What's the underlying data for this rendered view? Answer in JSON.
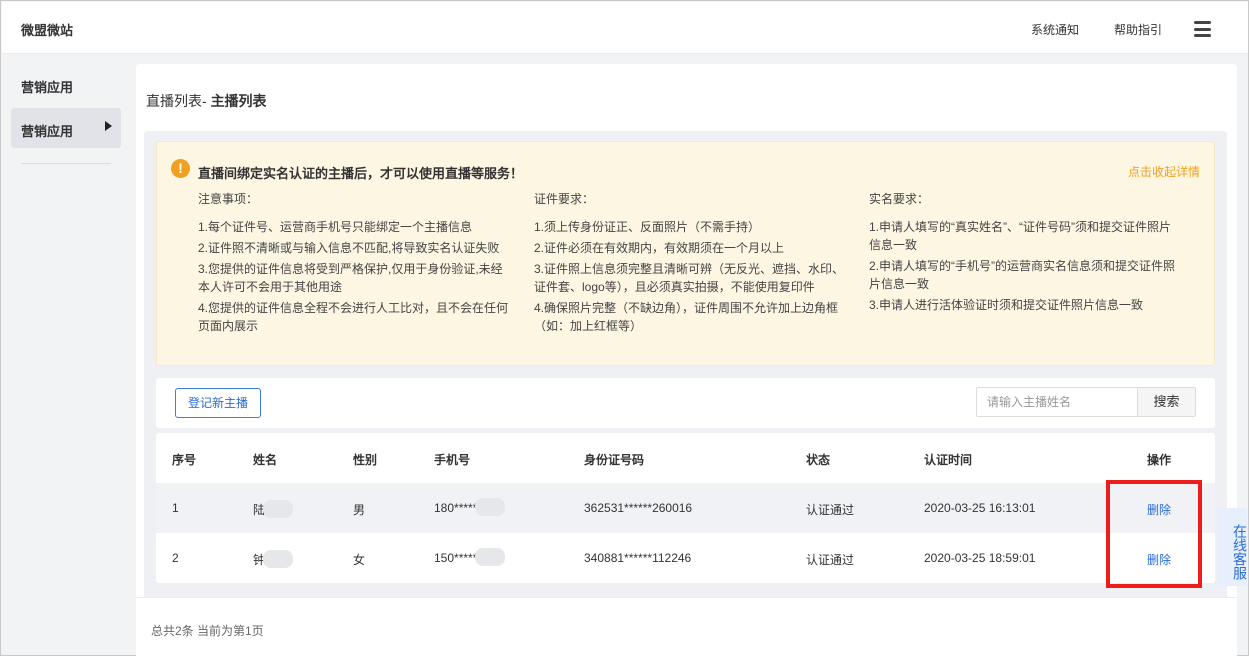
{
  "header": {
    "brand": "微盟微站",
    "nav": [
      "系统通知",
      "帮助指引"
    ],
    "menu_icon": "hamburger-menu-icon"
  },
  "sidebar": {
    "heading": "营销应用",
    "items": [
      {
        "label": "营销应用"
      }
    ]
  },
  "breadcrumb": {
    "parent": "直播列表- ",
    "current": "主播列表"
  },
  "notice": {
    "icon": "exclamation-icon",
    "title": "直播间绑定实名认证的主播后，才可以使用直播等服务！",
    "toggle": "点击收起详情",
    "columns": [
      {
        "title": "注意事项：",
        "items": [
          "1.每个证件号、运营商手机号只能绑定一个主播信息",
          "2.证件照不清晰或与输入信息不匹配,将导致实名认证失败",
          "3.您提供的证件信息将受到严格保护,仅用于身份验证,未经本人许可不会用于其他用途",
          "4.您提供的证件信息全程不会进行人工比对，且不会在任何页面内展示"
        ]
      },
      {
        "title": "证件要求：",
        "items": [
          "1.须上传身份证正、反面照片（不需手持）",
          "2.证件必须在有效期内，有效期须在一个月以上",
          "3.证件照上信息须完整且清晰可辨（无反光、遮挡、水印、证件套、logo等），且必须真实拍摄，不能使用复印件",
          "4.确保照片完整（不缺边角），证件周围不允许加上边角框（如：加上红框等）"
        ]
      },
      {
        "title": "实名要求：",
        "items": [
          "1.申请人填写的“真实姓名”、“证件号码”须和提交证件照片信息一致",
          "2.申请人填写的“手机号”的运营商实名信息须和提交证件照片信息一致",
          "3.申请人进行活体验证时须和提交证件照片信息一致"
        ]
      }
    ]
  },
  "toolbar": {
    "register_label": "登记新主播",
    "search_placeholder": "请输入主播姓名",
    "search_label": "搜索"
  },
  "table": {
    "headers": [
      "序号",
      "姓名",
      "性别",
      "手机号",
      "身份证号码",
      "状态",
      "认证时间",
      "操作"
    ],
    "rows": [
      {
        "index": "1",
        "name": "陆",
        "gender": "男",
        "phone": "180*****",
        "id_number": "362531******260016",
        "status": "认证通过",
        "time": "2020-03-25 16:13:01",
        "action": "删除"
      },
      {
        "index": "2",
        "name": "钟",
        "gender": "女",
        "phone": "150*****",
        "id_number": "340881******112246",
        "status": "认证通过",
        "time": "2020-03-25 18:59:01",
        "action": "删除"
      }
    ]
  },
  "footer": {
    "summary": "总共2条 当前为第1页"
  },
  "service": {
    "label": "在线客服"
  },
  "colors": {
    "accent": "#2a6dd4",
    "warning": "#f0a020",
    "highlight_box": "#ef1c1c"
  }
}
